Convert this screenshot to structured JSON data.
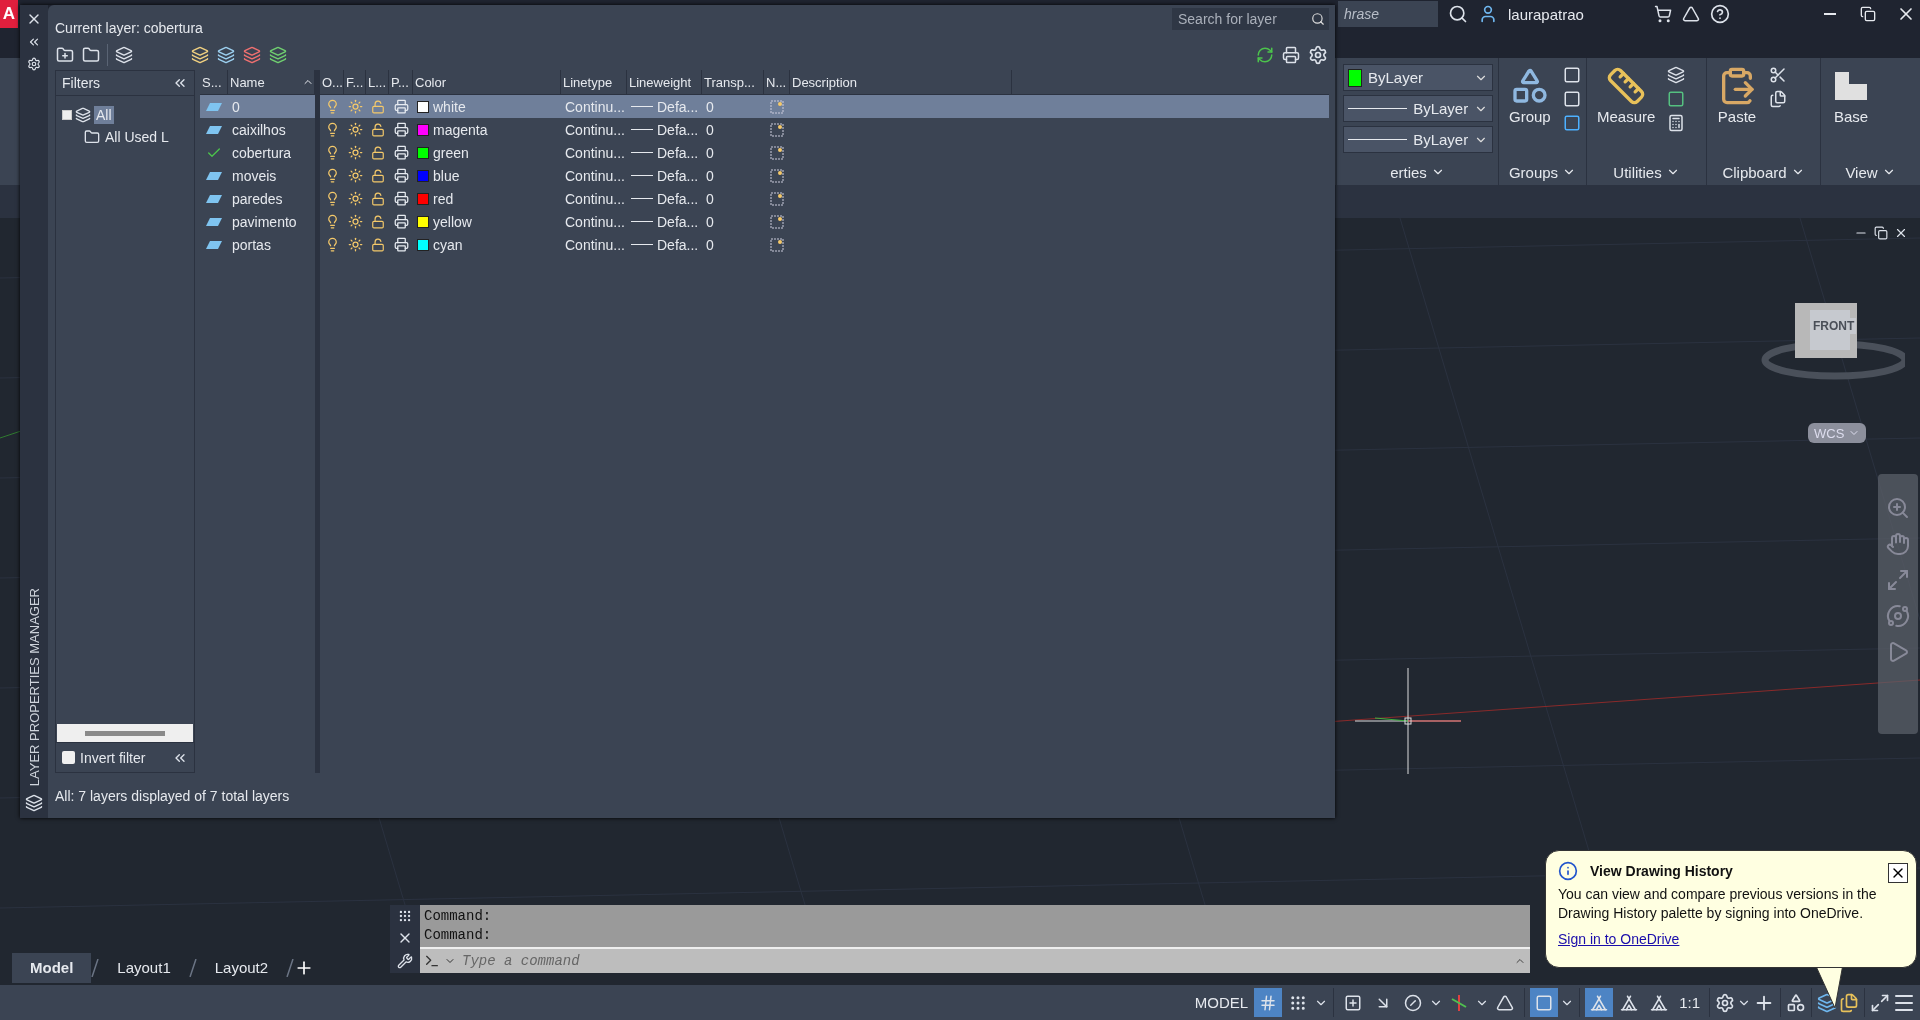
{
  "app_logo": "A",
  "search": {
    "placeholder": "hrase"
  },
  "user": {
    "name": "laurapatrao"
  },
  "ribbon": {
    "combos": [
      {
        "label": "ByLayer",
        "kind": "color",
        "color": "#00ff00"
      },
      {
        "label": "ByLayer",
        "kind": "line"
      },
      {
        "label": "ByLayer",
        "kind": "line"
      }
    ],
    "panels": [
      {
        "kind": "properties",
        "title": "erties"
      },
      {
        "kind": "groups",
        "title": "Groups",
        "tool": "Group"
      },
      {
        "kind": "utilities",
        "title": "Utilities",
        "tool": "Measure"
      },
      {
        "kind": "clipboard",
        "title": "Clipboard",
        "tool": "Paste"
      },
      {
        "kind": "view",
        "title": "View",
        "tool": "Base"
      }
    ]
  },
  "layer_palette": {
    "current_layer": "Current layer: cobertura",
    "search_placeholder": "Search for layer",
    "side_label": "LAYER PROPERTIES MANAGER",
    "filters": {
      "title": "Filters",
      "tree": [
        {
          "label": "All",
          "selected": true,
          "children": [
            {
              "label": "All Used L",
              "selected": false
            }
          ]
        }
      ],
      "invert_filter": {
        "label": "Invert filter",
        "checked": false
      }
    },
    "columns": [
      "S...",
      "Name",
      "O...",
      "F...",
      "L...",
      "P...",
      "Color",
      "Linetype",
      "Lineweight",
      "Transp...",
      "N...",
      "Description"
    ],
    "layers": [
      {
        "kind": "layer",
        "name": "0",
        "selected": true,
        "on": true,
        "frozen": false,
        "locked": false,
        "plot": true,
        "color_name": "white",
        "color": "#ffffff",
        "linetype": "Continu...",
        "lineweight": "Defa...",
        "transparency": "0"
      },
      {
        "kind": "layer",
        "name": "caixilhos",
        "selected": false,
        "on": true,
        "frozen": false,
        "locked": false,
        "plot": true,
        "color_name": "magenta",
        "color": "#ff00ff",
        "linetype": "Continu...",
        "lineweight": "Defa...",
        "transparency": "0"
      },
      {
        "kind": "current",
        "name": "cobertura",
        "selected": false,
        "on": true,
        "frozen": false,
        "locked": false,
        "plot": true,
        "color_name": "green",
        "color": "#00ff00",
        "linetype": "Continu...",
        "lineweight": "Defa...",
        "transparency": "0"
      },
      {
        "kind": "layer",
        "name": "moveis",
        "selected": false,
        "on": true,
        "frozen": false,
        "locked": false,
        "plot": true,
        "color_name": "blue",
        "color": "#0000ff",
        "linetype": "Continu...",
        "lineweight": "Defa...",
        "transparency": "0"
      },
      {
        "kind": "layer",
        "name": "paredes",
        "selected": false,
        "on": true,
        "frozen": false,
        "locked": false,
        "plot": true,
        "color_name": "red",
        "color": "#ff0000",
        "linetype": "Continu...",
        "lineweight": "Defa...",
        "transparency": "0"
      },
      {
        "kind": "layer",
        "name": "pavimento",
        "selected": false,
        "on": true,
        "frozen": false,
        "locked": false,
        "plot": true,
        "color_name": "yellow",
        "color": "#ffff00",
        "linetype": "Continu...",
        "lineweight": "Defa...",
        "transparency": "0"
      },
      {
        "kind": "layer",
        "name": "portas",
        "selected": false,
        "on": true,
        "frozen": false,
        "locked": false,
        "plot": true,
        "color_name": "cyan",
        "color": "#00ffff",
        "linetype": "Continu...",
        "lineweight": "Defa...",
        "transparency": "0"
      }
    ],
    "status": "All: 7 layers displayed of 7 total layers"
  },
  "viewcube": {
    "face": "FRONT",
    "ucs": "WCS"
  },
  "command_line": {
    "history": [
      "Command:",
      "Command:"
    ],
    "placeholder": "Type a command"
  },
  "layout_tabs": [
    {
      "label": "Model",
      "selected": true
    },
    {
      "label": "Layout1",
      "selected": false
    },
    {
      "label": "Layout2",
      "selected": false
    }
  ],
  "status_bar": {
    "model": "MODEL",
    "scale": "1:1",
    "toggles": [
      {
        "kind": "grid",
        "on": true
      },
      {
        "kind": "snap",
        "on": false
      },
      {
        "kind": "infer",
        "on": false
      },
      {
        "kind": "ortho",
        "on": false
      },
      {
        "kind": "polar",
        "on": false
      },
      {
        "kind": "track",
        "on": false
      },
      {
        "kind": "iso",
        "on": false
      },
      {
        "kind": "osnap",
        "on": true
      },
      {
        "kind": "annotation",
        "on": true
      },
      {
        "kind": "autoscale",
        "on": false
      },
      {
        "kind": "annoscale",
        "on": false
      }
    ]
  },
  "notification": {
    "title": "View Drawing History",
    "body": "You can view and compare previous versions in the Drawing History palette by signing into OneDrive.",
    "link": "Sign in to OneDrive"
  }
}
